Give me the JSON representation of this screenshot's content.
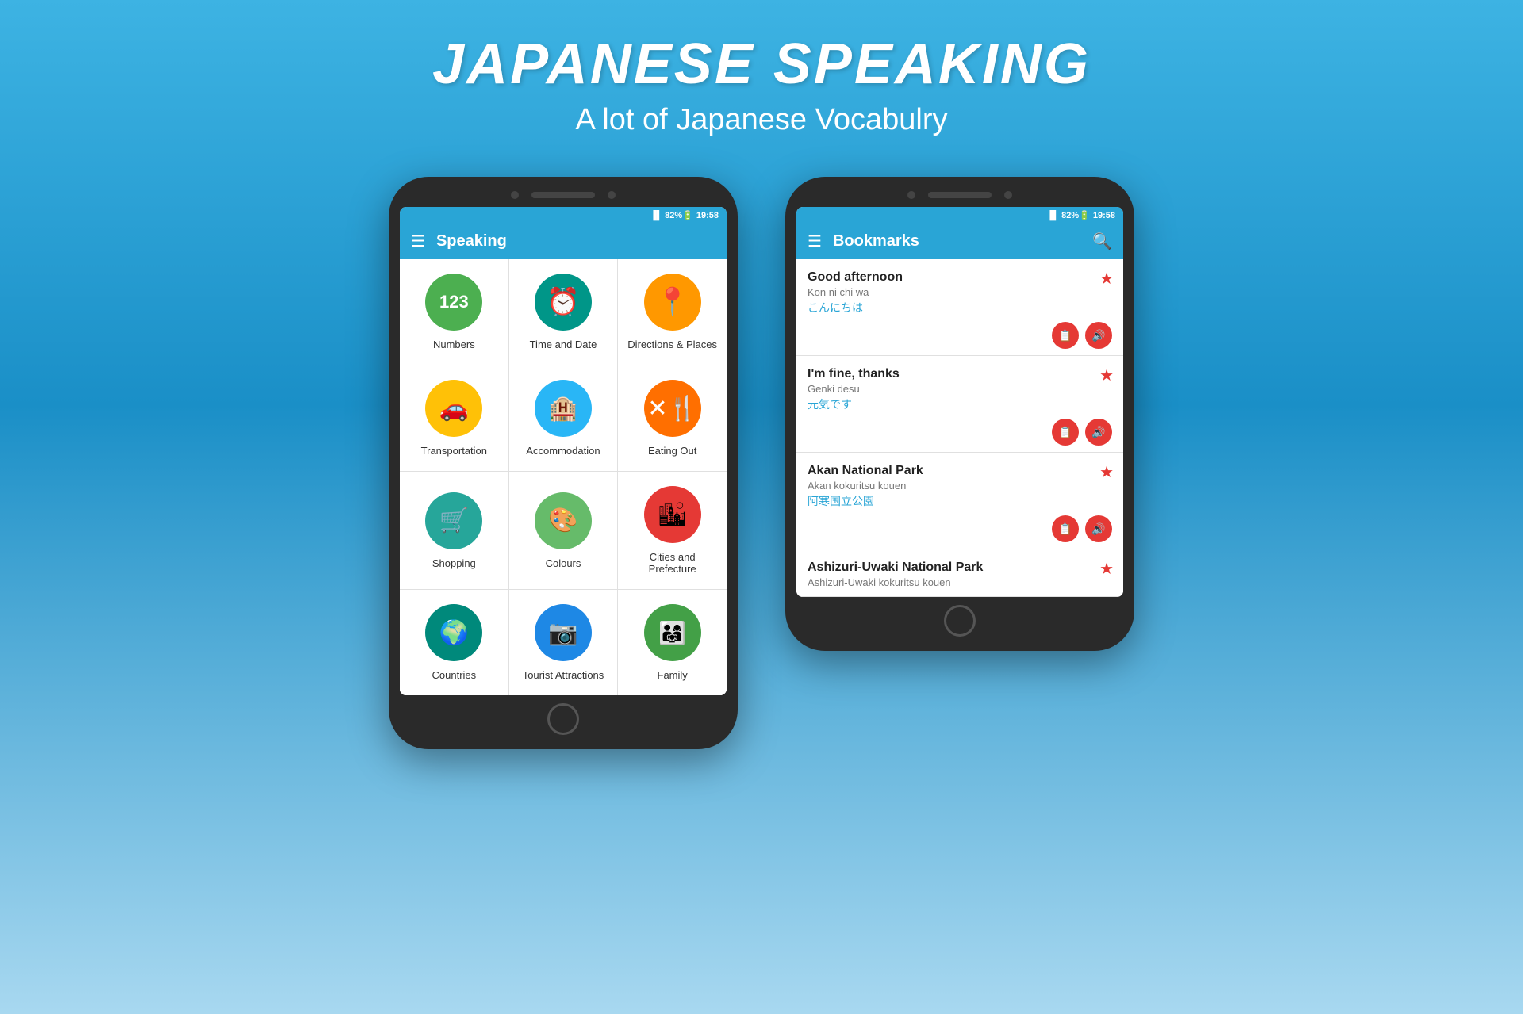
{
  "header": {
    "title": "JAPANESE SPEAKING",
    "subtitle": "A lot of Japanese Vocabulry"
  },
  "phone_left": {
    "status": {
      "signal": "▐▌",
      "battery": "82%",
      "time": "19:58"
    },
    "appbar": {
      "title": "Speaking"
    },
    "categories": [
      {
        "label": "Numbers",
        "icon": "123",
        "bg": "bg-green"
      },
      {
        "label": "Time and Date",
        "icon": "⏰",
        "bg": "bg-teal"
      },
      {
        "label": "Directions & Places",
        "icon": "📍",
        "bg": "bg-orange-map"
      },
      {
        "label": "Transportation",
        "icon": "🚗",
        "bg": "bg-yellow"
      },
      {
        "label": "Accommodation",
        "icon": "🏨",
        "bg": "bg-blue-light"
      },
      {
        "label": "Eating Out",
        "icon": "🍴",
        "bg": "bg-orange"
      },
      {
        "label": "Shopping",
        "icon": "🛒",
        "bg": "bg-teal2"
      },
      {
        "label": "Colours",
        "icon": "🎨",
        "bg": "bg-green2"
      },
      {
        "label": "Cities and Prefecture",
        "icon": "🏙",
        "bg": "bg-red"
      },
      {
        "label": "Countries",
        "icon": "🌍",
        "bg": "bg-teal3"
      },
      {
        "label": "Tourist Attractions",
        "icon": "📷",
        "bg": "bg-blue2"
      },
      {
        "label": "Family",
        "icon": "👨‍👩‍👧",
        "bg": "bg-green3"
      }
    ]
  },
  "phone_right": {
    "status": {
      "signal": "▐▌",
      "battery": "82%",
      "time": "19:58"
    },
    "appbar": {
      "title": "Bookmarks"
    },
    "bookmarks": [
      {
        "title": "Good afternoon",
        "romaji": "Kon ni chi wa",
        "japanese": "こんにちは"
      },
      {
        "title": "I'm fine, thanks",
        "romaji": "Genki desu",
        "japanese": "元気です"
      },
      {
        "title": "Akan National Park",
        "romaji": "Akan kokuritsu kouen",
        "japanese": "阿寒国立公園"
      },
      {
        "title": "Ashizuri-Uwaki National Park",
        "romaji": "Ashizuri-Uwaki kokuritsu kouen",
        "japanese": ""
      }
    ]
  }
}
